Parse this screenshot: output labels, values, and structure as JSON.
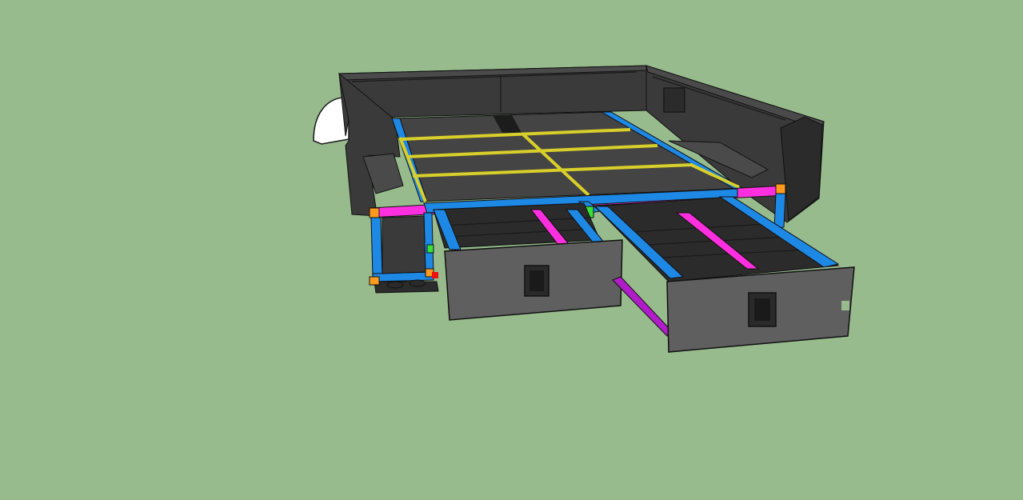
{
  "scene": {
    "subject": "truck-bed-drawer-system-3d-model",
    "background_color": "#98bb8e",
    "colors": {
      "bed_body": "#3a3a3a",
      "bed_dark": "#2b2b2b",
      "bed_top": "#4a4a4a",
      "deck_panel": "#444444",
      "frame_blue": "#1e88e5",
      "frame_magenta": "#ff2fe0",
      "rail_purple": "#b11cc9",
      "seam_yellow": "#d8cf2a",
      "corner_orange": "#ff9a1f",
      "block_green": "#39e03a",
      "drawer_face": "#5f5f5f",
      "wheel_well": "#ffffff"
    },
    "drawers": [
      {
        "name": "left-drawer",
        "state": "partially-open"
      },
      {
        "name": "right-drawer",
        "state": "open"
      }
    ]
  }
}
